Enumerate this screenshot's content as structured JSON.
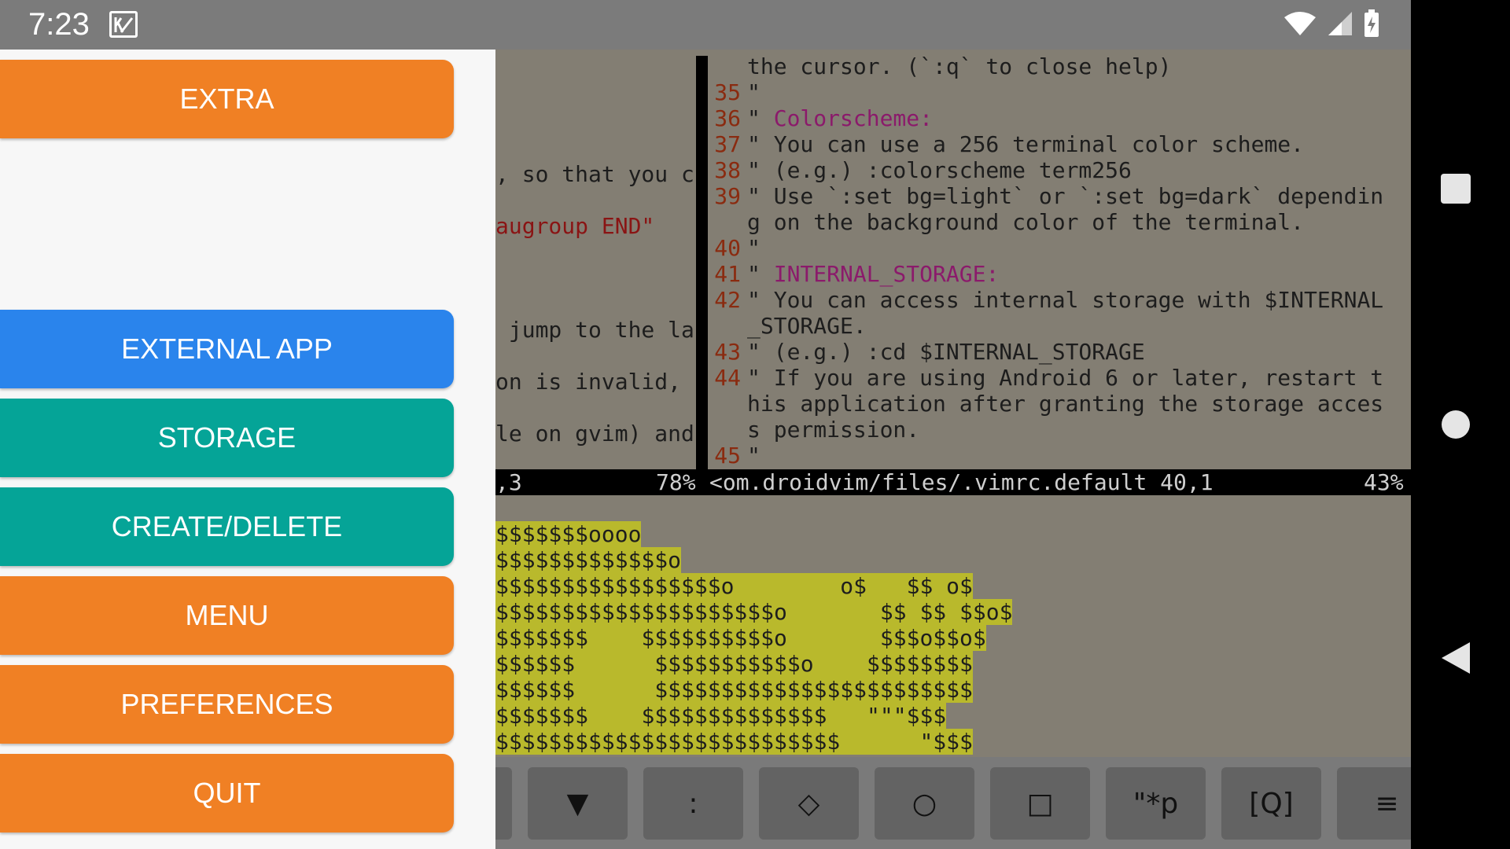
{
  "status_bar": {
    "time": "7:23",
    "icons": [
      "app-notification-icon",
      "wifi-icon",
      "cell-signal-icon",
      "battery-charging-icon"
    ]
  },
  "drawer": {
    "buttons": [
      {
        "label": "EXTRA",
        "color": "#f08024"
      },
      {
        "label": "EXTERNAL APP",
        "color": "#2a84ec"
      },
      {
        "label": "STORAGE",
        "color": "#05a497"
      },
      {
        "label": "CREATE/DELETE",
        "color": "#05a497"
      },
      {
        "label": "MENU",
        "color": "#f08024"
      },
      {
        "label": "PREFERENCES",
        "color": "#f08024"
      },
      {
        "label": "QUIT",
        "color": "#f08024"
      }
    ]
  },
  "left_pane": {
    "lines": [
      ", so that you c",
      "augroup END\"",
      " jump to the la",
      "on is invalid, ",
      "le on gvim) and"
    ]
  },
  "right_pane": {
    "lines": [
      {
        "num": "",
        "text": "the cursor. (`:q` to close help)"
      },
      {
        "num": "35",
        "text": "\""
      },
      {
        "num": "36",
        "text": "\" ",
        "hl": "Colorscheme:"
      },
      {
        "num": "37",
        "text": "\" You can use a 256 terminal color scheme."
      },
      {
        "num": "38",
        "text": "\" (e.g.) :colorscheme term256"
      },
      {
        "num": "39",
        "text": "\" Use `:set bg=light` or `:set bg=dark` dependin"
      },
      {
        "num": "",
        "text": "g on the background color of the terminal."
      },
      {
        "num": "40",
        "text": "\""
      },
      {
        "num": "41",
        "text": "\" ",
        "hl": "INTERNAL_STORAGE:"
      },
      {
        "num": "42",
        "text": "\" You can access internal storage with $INTERNAL"
      },
      {
        "num": "",
        "text": "_STORAGE."
      },
      {
        "num": "43",
        "text": "\" (e.g.) :cd $INTERNAL_STORAGE"
      },
      {
        "num": "44",
        "text": "\" If you are using Android 6 or later, restart t"
      },
      {
        "num": "",
        "text": "his application after granting the storage acces"
      },
      {
        "num": "",
        "text": "s permission."
      },
      {
        "num": "45",
        "text": "\""
      }
    ]
  },
  "statusline": {
    "left_pos": ",3",
    "left_pct": "78%",
    "file": "<om.droidvim/files/.vimrc.default 40,1",
    "right_pct": "43%"
  },
  "art": {
    "lines": [
      {
        "hl": "$$$$$$$oooo",
        "rest": ""
      },
      {
        "hl": "$$$$$$$$$$$$$o",
        "rest": ""
      },
      {
        "hl": "$$$$$$$$$$$$$$$$$o",
        "rest": "        o$   $$ o$"
      },
      {
        "hl": "$$$$$$$$$$$$$$$$$$$$$o",
        "rest": "       $$ $$ $$o$"
      },
      {
        "hl": "$$$$$$$",
        "rest": "    $$$$$$$$$$o       $$$o$$o$"
      },
      {
        "hl": "$$$$$$",
        "rest": "      $$$$$$$$$$$o    $$$$$$$$"
      },
      {
        "hl": "$$$$$$",
        "rest": "      $$$$$$$$$$$$$$$$$$$$$$$$"
      },
      {
        "hl": "$$$$$$$",
        "rest": "    $$$$$$$$$$$$$$   \"\"\"$$$"
      },
      {
        "hl": "$$$$$$$$$$$$$$$$$$$$$$$$$$",
        "rest": "      \"$$$"
      }
    ]
  },
  "toolbar": {
    "buttons": [
      "",
      "▼",
      ":",
      "◇",
      "○",
      "□",
      "\"*p",
      "[Q]",
      "≡"
    ]
  },
  "colors": {
    "status_bar": "#7b7b7b",
    "vim_background": "#837e73",
    "highlight": "#b9b92c",
    "line_number": "#8a2b10",
    "comment_title": "#8b1a6b"
  }
}
